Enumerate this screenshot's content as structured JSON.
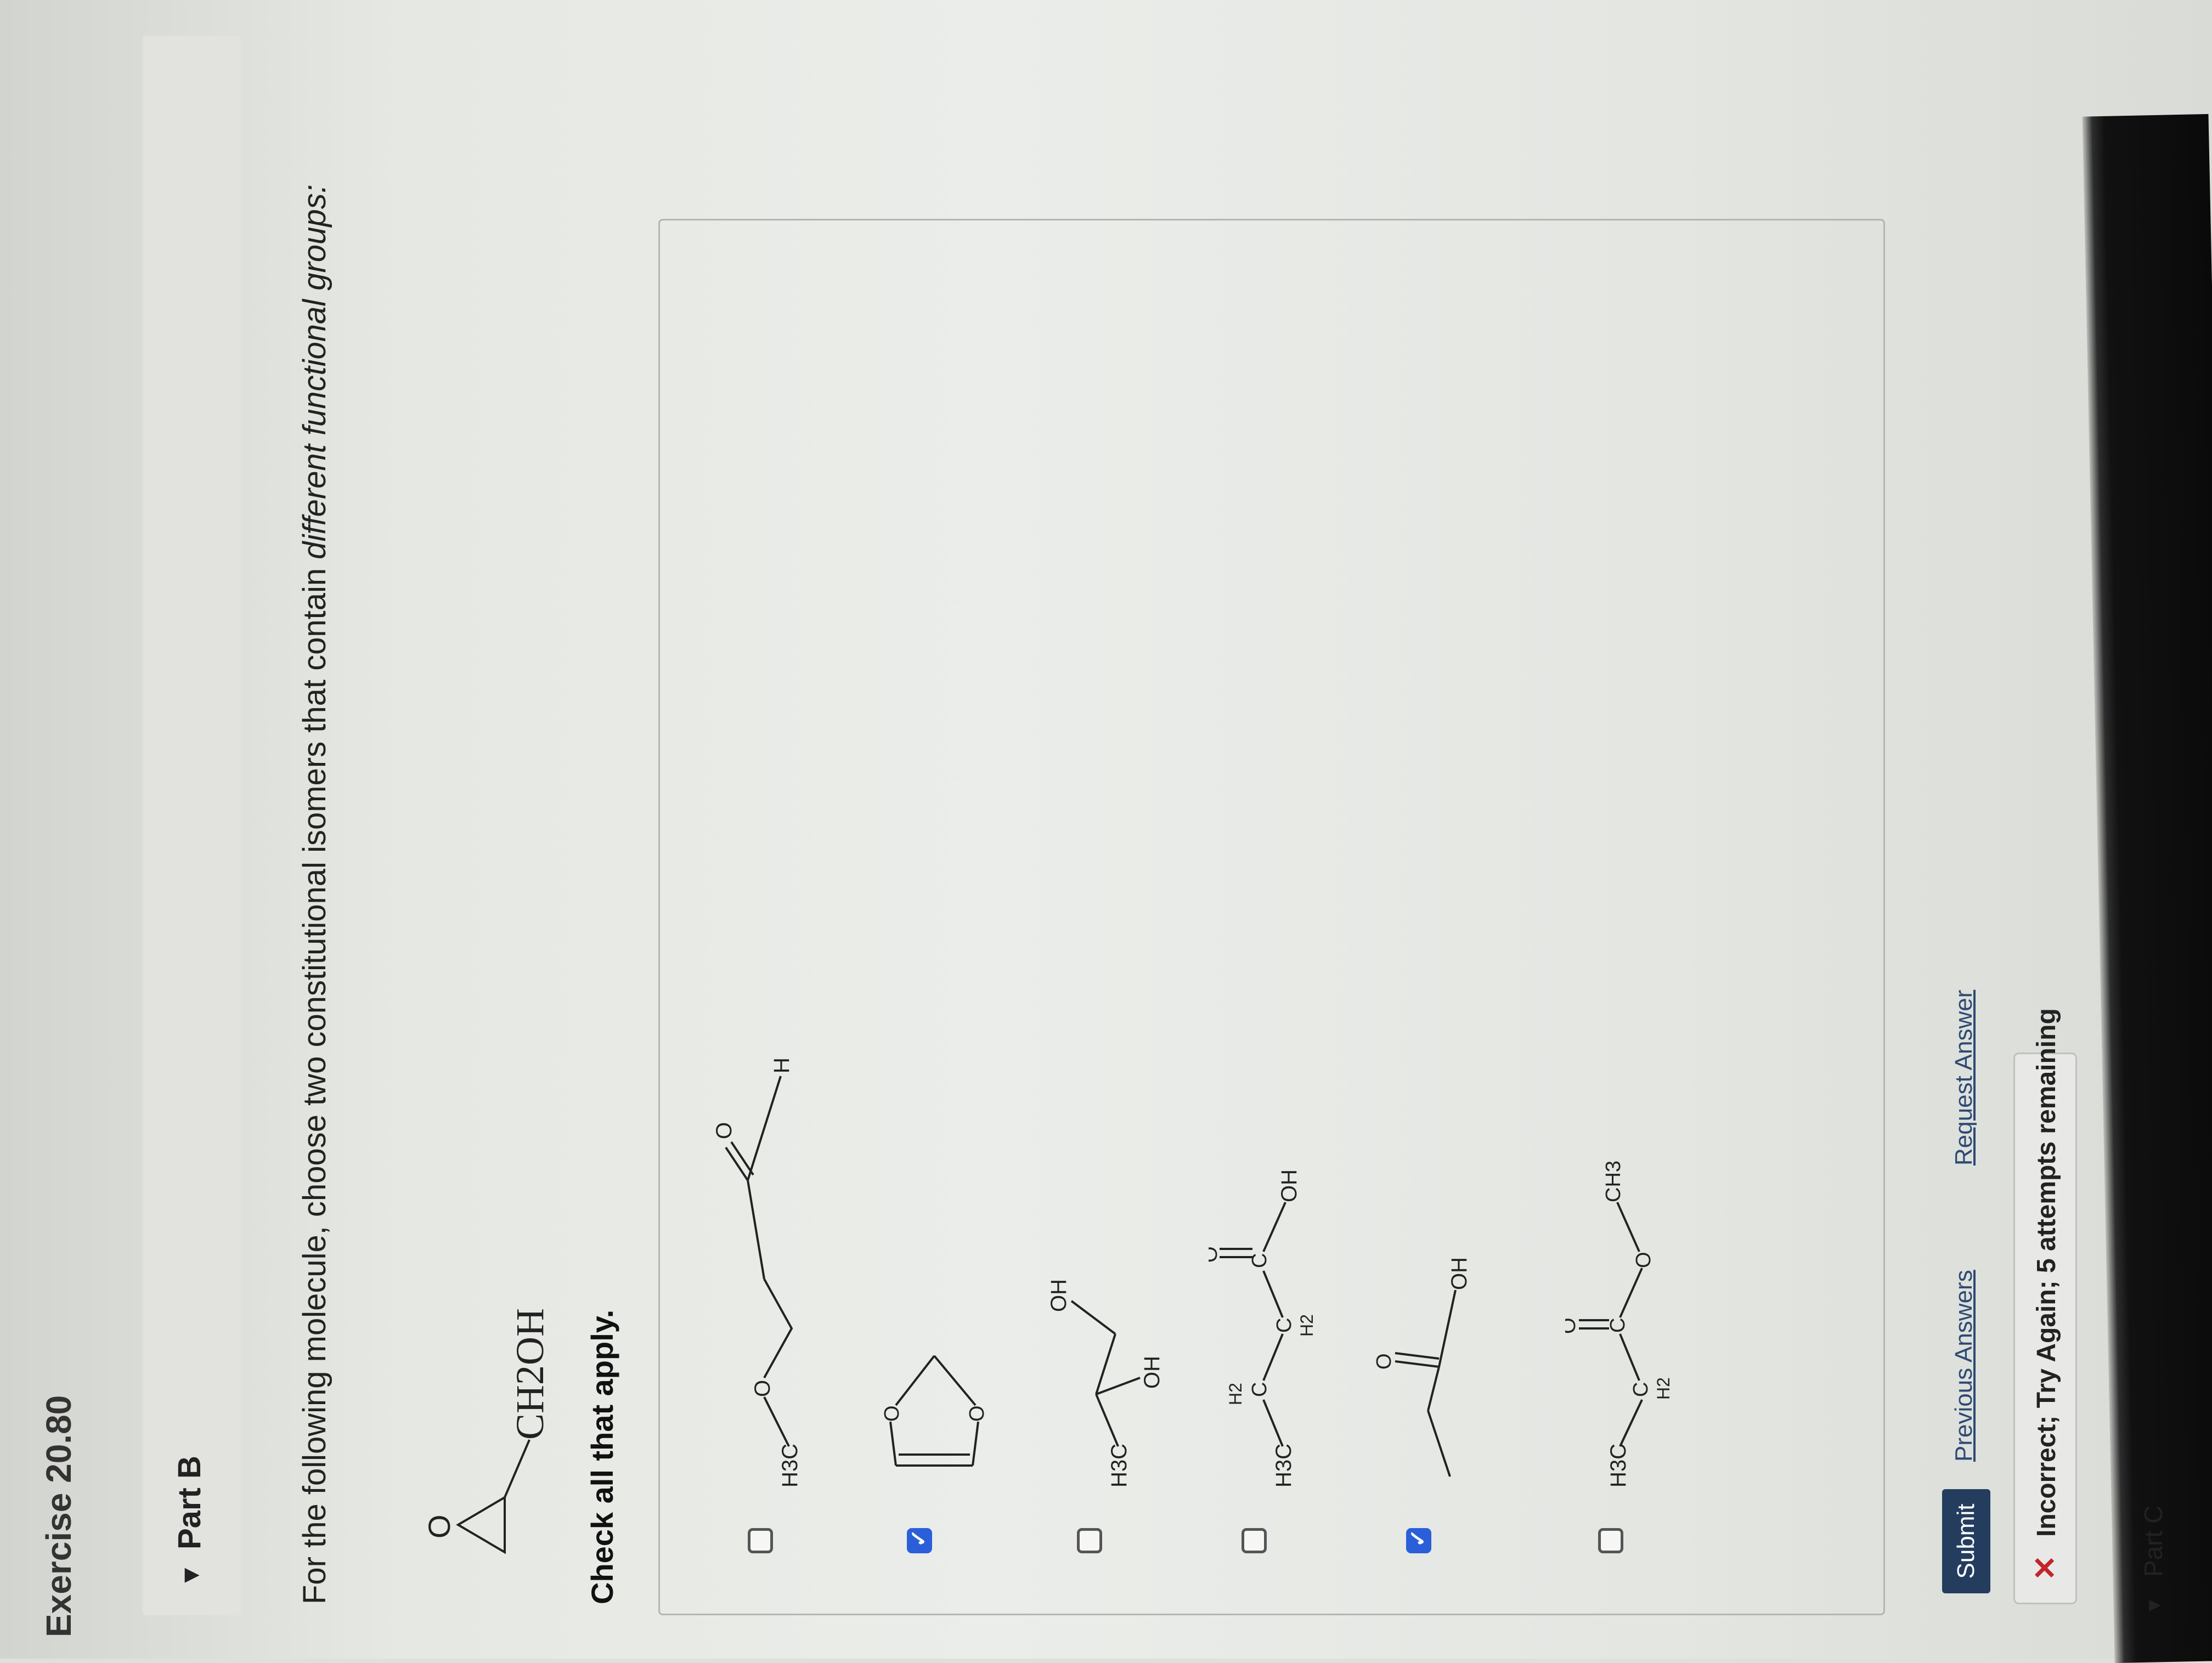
{
  "exercise": {
    "title": "Exercise 20.80"
  },
  "part_b": {
    "label": "Part B"
  },
  "question": {
    "text_plain": "For the following molecule, choose two constitutional isomers that contain ",
    "text_emph": "different functional groups:",
    "given_molecule_label": "CH2OH"
  },
  "instructions": {
    "check_all": "Check all that apply."
  },
  "options": [
    {
      "checked": false,
      "labels": {
        "h3c": "H3C",
        "o": "O",
        "o2": "O",
        "h": "H"
      }
    },
    {
      "checked": true,
      "labels": {
        "o1": "O",
        "o2": "O"
      }
    },
    {
      "checked": false,
      "labels": {
        "h3c": "H3C",
        "oh1": "OH",
        "oh2": "OH"
      }
    },
    {
      "checked": false,
      "labels": {
        "h3c": "H3C",
        "c1": "C",
        "h2a": "H2",
        "c2": "C",
        "h2b": "H2",
        "c3": "C",
        "o": "O",
        "oh": "OH"
      }
    },
    {
      "checked": true,
      "labels": {
        "o": "O",
        "oh": "OH"
      }
    },
    {
      "checked": false,
      "labels": {
        "h3c": "H3C",
        "c1": "C",
        "h2": "H2",
        "c2": "C",
        "o1": "O",
        "o2": "O",
        "ch3": "CH3"
      }
    }
  ],
  "actions": {
    "submit": "Submit",
    "previous_answers": "Previous Answers",
    "request_answer": "Request Answer"
  },
  "feedback": {
    "icon": "x-icon",
    "text": "Incorrect; Try Again; 5 attempts remaining",
    "color": "#c2252a"
  },
  "part_c": {
    "label": "Part C"
  },
  "colors": {
    "accent": "#2b5fd9",
    "submit_bg": "#243d5e",
    "link": "#2d4a73"
  }
}
